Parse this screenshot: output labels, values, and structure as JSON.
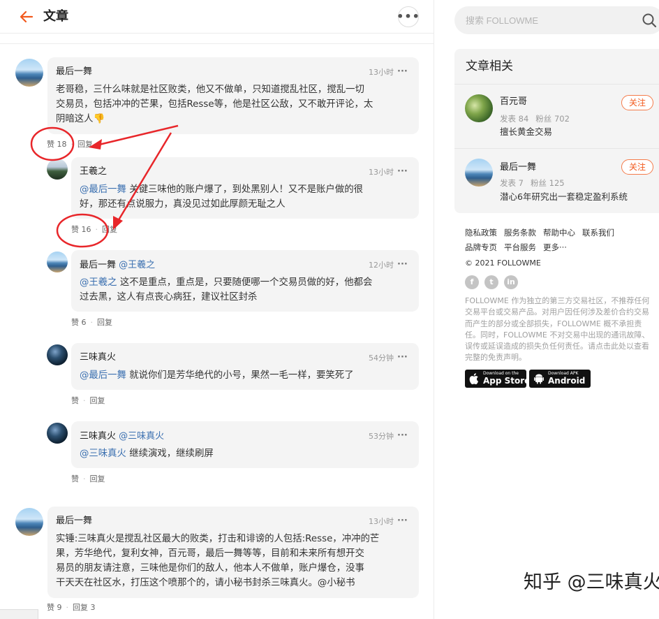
{
  "header": {
    "title": "文章"
  },
  "comments": [
    {
      "name": "最后一舞",
      "time": "13小时",
      "lines": [
        "老哥稳，三什么味就是社区败类，他又不做单，只知道搅乱社区，搅乱一切",
        "交易员，包括冲冲的芒果，包括Resse等，他是社区公敌，又不敢开评论，太",
        "阴暗这人👎"
      ],
      "likes": "赞 18",
      "reply": "回复"
    },
    {
      "name": "王羲之",
      "time": "13小时",
      "mention": "@最后一舞",
      "lines": [
        " 关键三味他的账户爆了，到处黑别人！又不是账户做的很",
        "好，那还有点说服力，真没见过如此厚颜无耻之人"
      ],
      "likes": "赞 16",
      "reply": "回复"
    },
    {
      "name": "最后一舞",
      "name_mention": "@王羲之",
      "time": "12小时",
      "mention": "@王羲之",
      "lines": [
        " 这不是重点，重点是，只要随便哪一个交易员做的好，他都会",
        "过去黑，这人有点丧心病狂，建议社区封杀"
      ],
      "likes": "赞 6",
      "reply": "回复"
    },
    {
      "name": "三味真火",
      "time": "54分钟",
      "mention": "@最后一舞",
      "lines": [
        " 就说你们是芳华绝代的小号，果然一毛一样，要笑死了"
      ],
      "likes": "赞",
      "reply": "回复"
    },
    {
      "name": "三味真火",
      "name_mention": "@三味真火",
      "time": "53分钟",
      "mention": "@三味真火",
      "lines": [
        " 继续演戏，继续刷屏"
      ],
      "likes": "赞",
      "reply": "回复"
    },
    {
      "name": "最后一舞",
      "time": "13小时",
      "lines": [
        "实锤:三味真火是搅乱社区最大的败类，打击和诽谤的人包括:Resse，冲冲的芒",
        "果，芳华绝代，复利女神，百元哥，最后一舞等等，目前和未来所有想开交",
        "易员的朋友请注意，三味他是你们的敌人，他本人不做单，账户爆仓，没事",
        "干天天在社区水，打压这个喷那个的，请小秘书封杀三味真火。@小秘书"
      ],
      "likes": "赞 9",
      "reply": "回复 3"
    }
  ],
  "search": {
    "placeholder": "搜索 FOLLOWME"
  },
  "related": {
    "title": "文章相关",
    "authors": [
      {
        "name": "百元哥",
        "posts": "发表 84",
        "fans": "粉丝 702",
        "desc": "擅长黄金交易",
        "follow": "关注"
      },
      {
        "name": "最后一舞",
        "posts": "发表 7",
        "fans": "粉丝 125",
        "desc": "潜心6年研究出一套稳定盈利系统",
        "follow": "关注"
      }
    ]
  },
  "footer": {
    "row1": [
      "隐私政策",
      "服务条款",
      "帮助中心",
      "联系我们"
    ],
    "row2": [
      "品牌专页",
      "平台服务",
      "更多···"
    ],
    "copyright": "© 2021 FOLLOWME",
    "social": [
      "f",
      "t",
      "in"
    ],
    "disclaimer": "FOLLOWME 作为独立的第三方交易社区，不推荐任何交易平台或交易产品。对用户因任何涉及差价合约交易而产生的部分或全部损失，FOLLOWME 概不承担责任。同时，FOLLOWME 不对交易中出现的通讯故障、误传或延误造成的损失负任何责任。请点击此处以查看完整的免责声明。",
    "appstore_small": "Download on the",
    "appstore_big": "App Store",
    "android_small": "Download APK",
    "android_big": "Android"
  },
  "watermark": "知乎 @三味真火",
  "colors": {
    "accent": "#f25a1e",
    "annotation": "#e8262a",
    "mention": "#3a6fb0"
  }
}
